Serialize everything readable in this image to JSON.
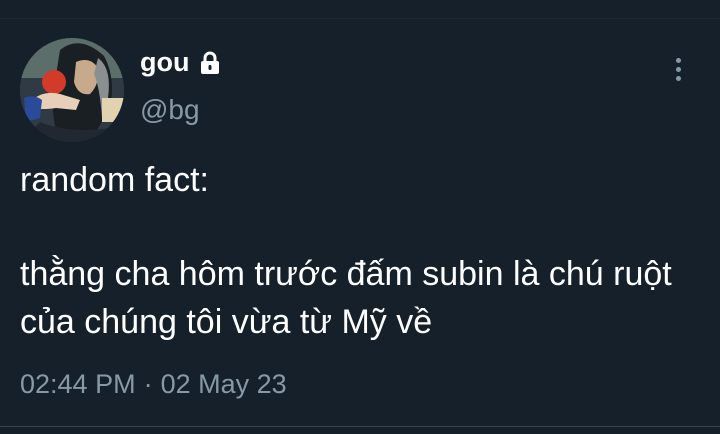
{
  "user": {
    "display_name": "gou",
    "handle": "@bg",
    "protected_icon": "lock-icon",
    "avatar_icon": "avatar-image"
  },
  "tweet": {
    "line1": "random fact:",
    "line2": "thằng cha hôm trước đấm subin là chú ruột của chúng tôi vừa từ Mỹ về"
  },
  "meta": {
    "time": "02:44 PM",
    "separator": "·",
    "date": "02 May 23"
  },
  "menu": {
    "icon": "more-vertical-icon"
  },
  "colors": {
    "background": "#15202b",
    "text": "#ffffff",
    "secondary": "#8899a6"
  }
}
